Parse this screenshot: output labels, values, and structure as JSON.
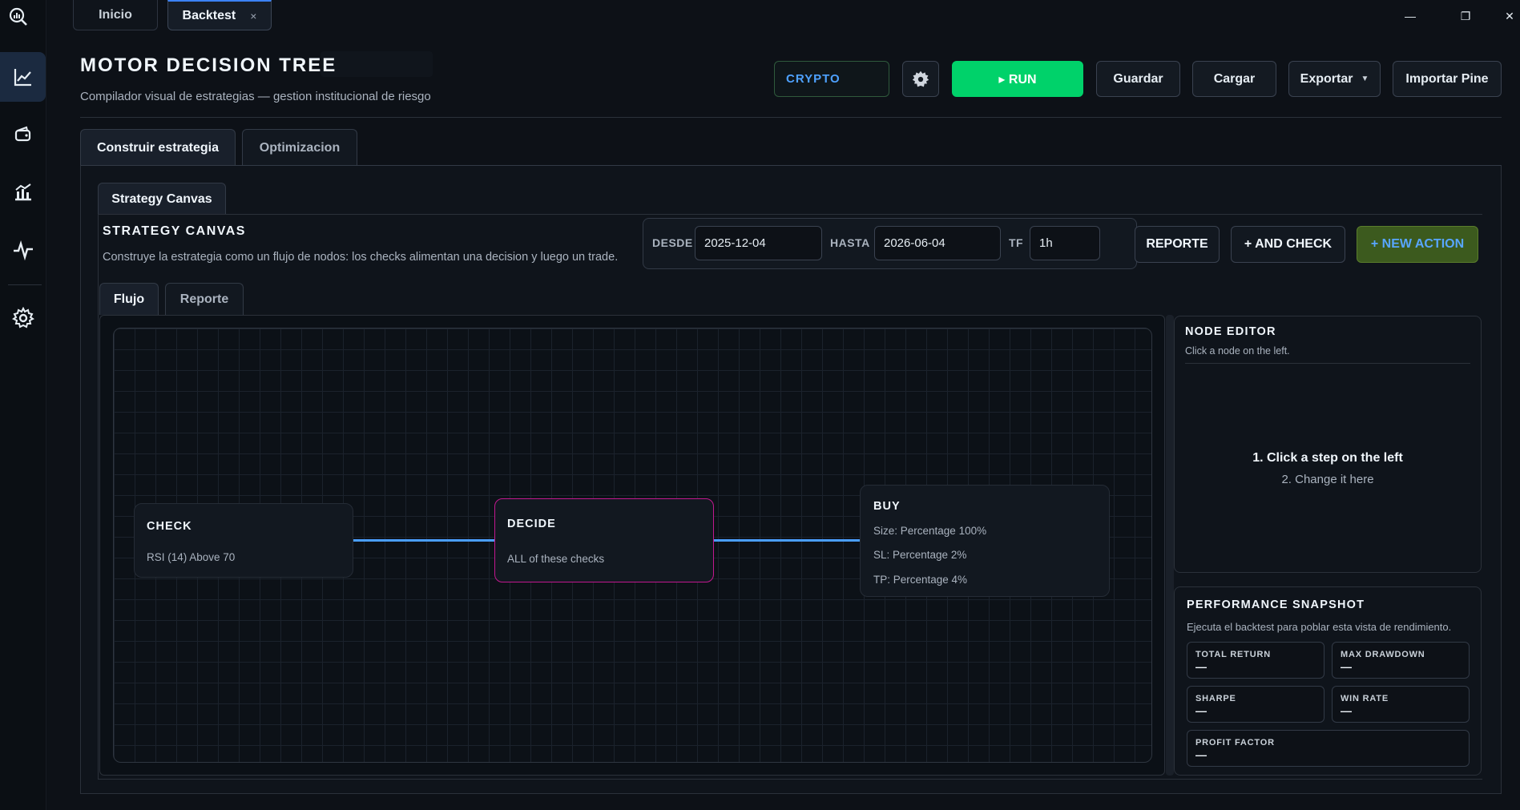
{
  "tabs": [
    {
      "label": "Inicio"
    },
    {
      "label": "Backtest",
      "close": "×"
    }
  ],
  "window": {
    "minimize": "—",
    "maximize": "❐",
    "close": "✕"
  },
  "header": {
    "title": "MOTOR DECISION TREE",
    "subtitle": "Compilador visual de estrategias — gestion institucional de riesgo",
    "market": "CRYPTO",
    "run": "▸ RUN",
    "save": "Guardar",
    "load": "Cargar",
    "export": "Exportar",
    "import": "Importar Pine"
  },
  "main_tabs": [
    {
      "label": "Construir estrategia"
    },
    {
      "label": "Optimizacion"
    }
  ],
  "canvas": {
    "subtab": "Strategy Canvas",
    "title": "STRATEGY CANVAS",
    "description": "Construye la estrategia como un flujo de nodos: los checks alimentan una decision y luego un trade.",
    "desde_label": "DESDE",
    "desde_value": "2025-12-04",
    "hasta_label": "HASTA",
    "hasta_value": "2026-06-04",
    "tf_label": "TF",
    "tf_value": "1h",
    "report_btn": "REPORTE",
    "and_check_btn": "+ AND CHECK",
    "new_action_btn": "+ NEW ACTION",
    "flow_tabs": [
      {
        "label": "Flujo"
      },
      {
        "label": "Reporte"
      }
    ]
  },
  "nodes": {
    "check": {
      "title": "CHECK",
      "lines": [
        "RSI (14) Above 70"
      ]
    },
    "decide": {
      "title": "DECIDE",
      "lines": [
        "ALL of these checks"
      ]
    },
    "buy": {
      "title": "BUY",
      "lines": [
        "Size: Percentage 100%",
        "SL: Percentage 2%",
        "TP: Percentage 4%"
      ]
    }
  },
  "node_editor": {
    "title": "NODE EDITOR",
    "hint": "Click a node on the left.",
    "step1": "1. Click a step on the left",
    "step2": "2. Change it here"
  },
  "performance": {
    "title": "PERFORMANCE SNAPSHOT",
    "subtitle": "Ejecuta el backtest para poblar esta vista de rendimiento.",
    "metrics": [
      {
        "label": "TOTAL RETURN",
        "value": "—"
      },
      {
        "label": "MAX DRAWDOWN",
        "value": "—"
      },
      {
        "label": "SHARPE",
        "value": "—"
      },
      {
        "label": "WIN RATE",
        "value": "—"
      },
      {
        "label": "PROFIT FACTOR",
        "value": "—"
      }
    ]
  },
  "colors": {
    "accent": "#3b82f6",
    "run": "#00d26a",
    "edge": "#4a9eff",
    "decide_border": "#c2188f"
  }
}
